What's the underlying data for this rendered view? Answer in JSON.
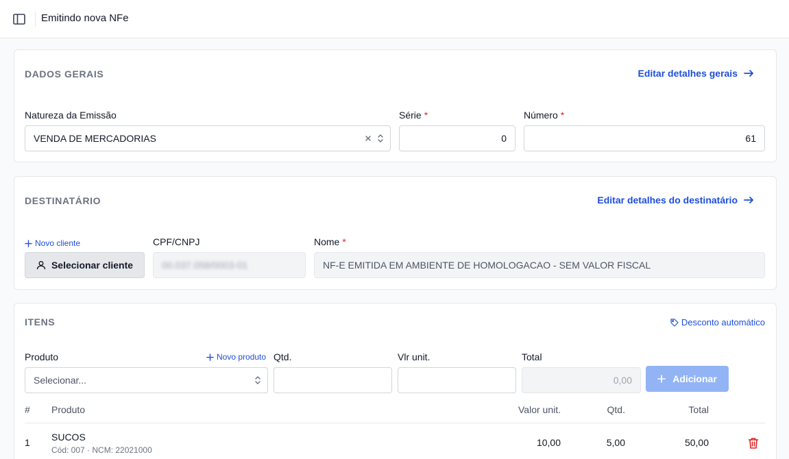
{
  "header": {
    "title": "Emitindo nova NFe"
  },
  "dados_gerais": {
    "title": "DADOS GERAIS",
    "edit_link": "Editar detalhes gerais",
    "natureza_label": "Natureza da Emissão",
    "natureza_value": "VENDA DE MERCADORIAS",
    "serie_label": "Série",
    "serie_value": "0",
    "numero_label": "Número",
    "numero_value": "61",
    "required_mark": "*"
  },
  "destinatario": {
    "title": "DESTINATÁRIO",
    "edit_link": "Editar detalhes do destinatário",
    "novo_cliente": "Novo cliente",
    "selecionar_cliente": "Selecionar cliente",
    "cpf_label": "CPF/CNPJ",
    "cpf_value": "00.037.058/0003-01",
    "nome_label": "Nome",
    "nome_value": "NF-E EMITIDA EM AMBIENTE DE HOMOLOGACAO - SEM VALOR FISCAL",
    "required_mark": "*"
  },
  "itens": {
    "title": "ITENS",
    "desconto_link": "Desconto automático",
    "produto_label": "Produto",
    "novo_produto": "Novo produto",
    "produto_placeholder": "Selecionar...",
    "qtd_label": "Qtd.",
    "vlr_unit_label": "Vlr unit.",
    "total_label": "Total",
    "total_value": "0,00",
    "add_button": "Adicionar",
    "columns": {
      "index": "#",
      "produto": "Produto",
      "valor_unit": "Valor unit.",
      "qtd": "Qtd.",
      "total": "Total"
    },
    "rows": [
      {
        "index": "1",
        "name": "SUCOS",
        "details": "Cód: 007 · NCM: 22021000",
        "valor_unit": "10,00",
        "qtd": "5,00",
        "total": "50,00"
      }
    ]
  },
  "colors": {
    "accent": "#1d4ed8",
    "required": "#dc2626",
    "primary_disabled": "#93b4f4",
    "danger": "#dc2626"
  },
  "icons": {
    "sidebar_toggle": "sidebar-toggle-icon",
    "arrow_right": "arrow-right-icon",
    "clear": "close-icon",
    "chevron_updown": "chevron-up-down-icon",
    "plus": "plus-icon",
    "user": "user-icon",
    "tag": "tag-icon",
    "trash": "trash-icon"
  }
}
